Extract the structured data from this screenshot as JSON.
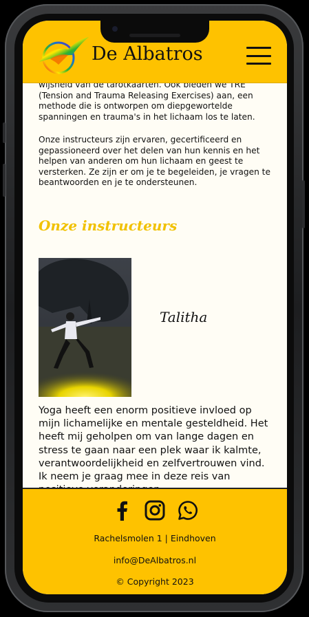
{
  "header": {
    "brand": "De Albatros",
    "logo_icon": "albatross-rainbow-logo-icon",
    "menu_icon": "hamburger-menu-icon"
  },
  "main": {
    "intro_paragraph_1": "wijsheid van de tarotkaarten. Ook bieden we TRE (Tension and Trauma Releasing Exercises) aan, een methode die is ontworpen om diepgewortelde spanningen en trauma's in het lichaam los te laten.",
    "intro_paragraph_2": "Onze instructeurs zijn ervaren, gecertificeerd en gepassioneerd over het delen van hun kennis en het helpen van anderen om hun lichaam en geest te versterken. Ze zijn er om je te begeleiden, je vragen te beantwoorden en je te ondersteunen.",
    "section_title": "Onze instructeurs",
    "instructor": {
      "name": "Talitha",
      "bio": "Yoga heeft een enorm positieve invloed op mijn lichamelijke en mentale gesteldheid. Het heeft mij geholpen om van lange dagen en stress te gaan naar een plek waar ik kalmte, verantwoordelijkheid en zelfvertrouwen vind. Ik neem je graag mee in deze reis van positieve veranderingen."
    }
  },
  "footer": {
    "social_icons": [
      "facebook-icon",
      "instagram-icon",
      "whatsapp-icon"
    ],
    "address": "Rachelsmolen 1 | Eindhoven",
    "email": "info@DeAlbatros.nl",
    "copyright": "© Copyright 2023"
  },
  "colors": {
    "brand_yellow": "#fec200",
    "title_yellow": "#f1c100",
    "page_background": "#fffdf5",
    "text": "#111111"
  }
}
